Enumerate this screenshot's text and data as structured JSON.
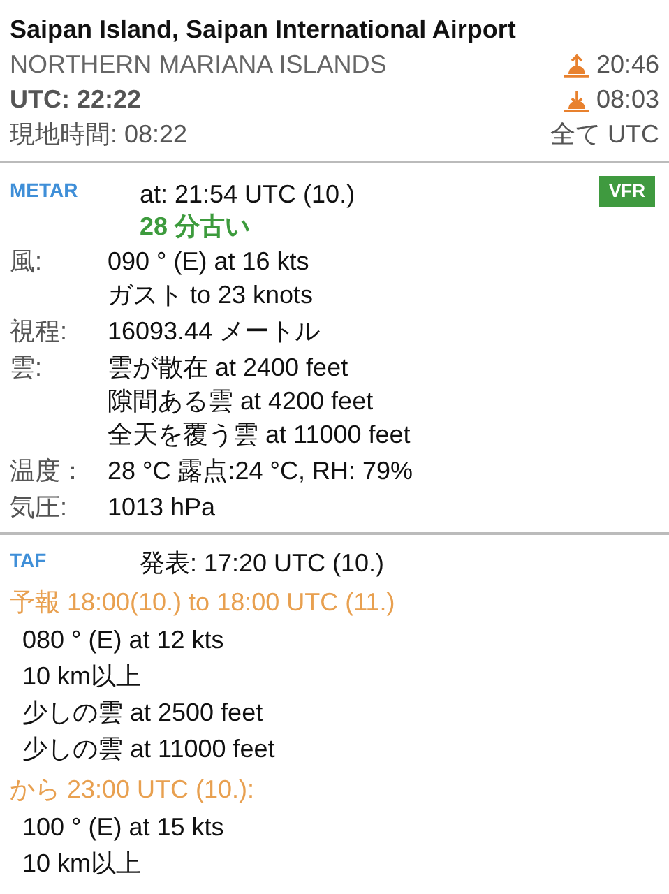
{
  "header": {
    "title": "Saipan Island, Saipan International Airport",
    "country": "NORTHERN MARIANA ISLANDS",
    "utc": "UTC: 22:22",
    "local_time": "現地時間: 08:22",
    "sun_times": [
      {
        "kind": "sunrise",
        "time": "20:46"
      },
      {
        "kind": "sunset",
        "time": "08:03"
      }
    ],
    "time_mode": "全て UTC"
  },
  "metar": {
    "label": "METAR",
    "time": "at:  21:54 UTC  (10.)",
    "age": "28 分古い",
    "badge": "VFR",
    "rows": [
      {
        "label": "風:",
        "lines": [
          "090 ° (E) at 16 kts",
          "ガスト to 23 knots"
        ]
      },
      {
        "label": "視程:",
        "lines": [
          "16093.44 メートル"
        ]
      },
      {
        "label": "雲:",
        "lines": [
          "雲が散在 at 2400 feet",
          "隙間ある雲 at 4200 feet",
          "全天を覆う雲 at 11000 feet"
        ]
      },
      {
        "label": "温度：",
        "lines": [
          "28 °C 露点:24 °C, RH: 79%"
        ]
      },
      {
        "label": "気圧:",
        "lines": [
          "1013 hPa"
        ]
      }
    ]
  },
  "taf": {
    "label": "TAF",
    "issued": "発表: 17:20 UTC  (10.)",
    "groups": [
      {
        "heading": "予報 18:00(10.) to 18:00 UTC (11.)",
        "lines": [
          "080 ° (E) at 12 kts",
          "10 km以上",
          "少しの雲 at 2500 feet",
          "少しの雲 at 11000 feet"
        ]
      },
      {
        "heading": "から 23:00 UTC (10.):",
        "lines": [
          "100 ° (E) at 15 kts",
          "10 km以上"
        ]
      }
    ]
  }
}
